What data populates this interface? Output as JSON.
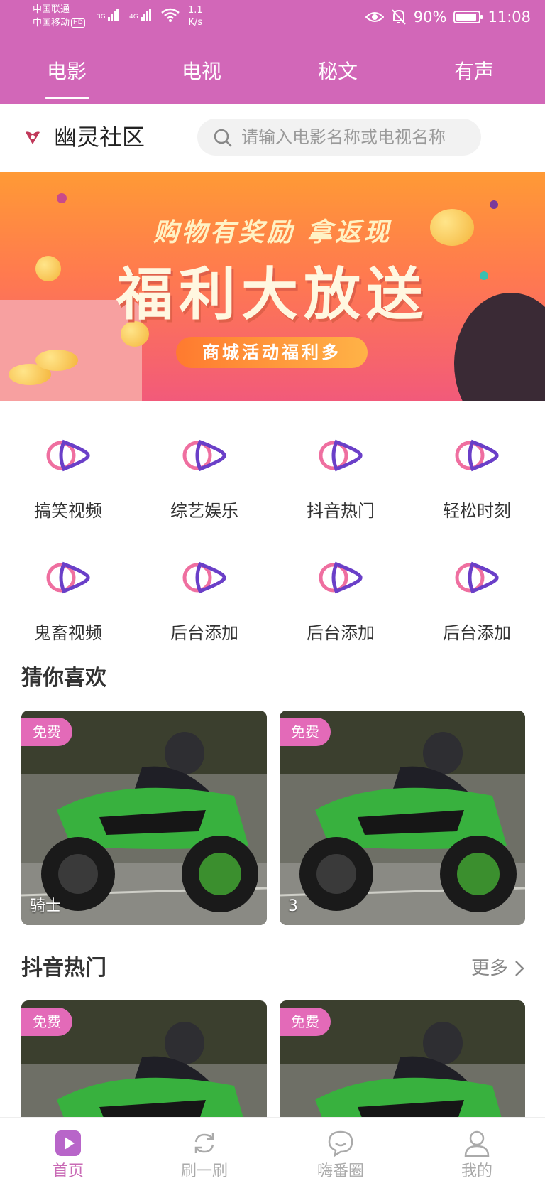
{
  "status_bar": {
    "carrier1": "中国联通",
    "carrier2": "中国移动",
    "hd": "HD",
    "net1": "3G",
    "net2": "4G",
    "speed_value": "1.1",
    "speed_unit": "K/s",
    "battery": "90%",
    "time": "11:08"
  },
  "tabs": [
    {
      "label": "电影",
      "active": true
    },
    {
      "label": "电视",
      "active": false
    },
    {
      "label": "秘文",
      "active": false
    },
    {
      "label": "有声",
      "active": false
    }
  ],
  "header": {
    "brand": "幽灵社区",
    "search_placeholder": "请输入电影名称或电视名称"
  },
  "banner": {
    "subtitle": "购物有奖励 拿返现",
    "title": "福利大放送",
    "pill": "商城活动福利多"
  },
  "categories": [
    {
      "label": "搞笑视频",
      "icon": "play-logo-icon"
    },
    {
      "label": "综艺娱乐",
      "icon": "play-logo-icon"
    },
    {
      "label": "抖音热门",
      "icon": "play-logo-icon"
    },
    {
      "label": "轻松时刻",
      "icon": "play-logo-icon"
    },
    {
      "label": "鬼畜视频",
      "icon": "play-logo-icon"
    },
    {
      "label": "后台添加",
      "icon": "play-logo-icon"
    },
    {
      "label": "后台添加",
      "icon": "play-logo-icon"
    },
    {
      "label": "后台添加",
      "icon": "play-logo-icon"
    }
  ],
  "sections": [
    {
      "title": "猜你喜欢",
      "more": "",
      "cards": [
        {
          "badge": "免费",
          "title": "骑士"
        },
        {
          "badge": "免费",
          "title": "3"
        }
      ]
    },
    {
      "title": "抖音热门",
      "more": "更多",
      "cards": [
        {
          "badge": "免费",
          "title": ""
        },
        {
          "badge": "免费",
          "title": ""
        }
      ]
    }
  ],
  "bottom_nav": [
    {
      "label": "首页",
      "icon": "home-play-icon",
      "active": true
    },
    {
      "label": "刷一刷",
      "icon": "refresh-icon",
      "active": false
    },
    {
      "label": "嗨番圈",
      "icon": "chat-bubble-icon",
      "active": false
    },
    {
      "label": "我的",
      "icon": "user-icon",
      "active": false
    }
  ],
  "colors": {
    "header_bg": "#d267b8",
    "accent": "#c96ab5",
    "badge_bg": "#e36ab8"
  }
}
